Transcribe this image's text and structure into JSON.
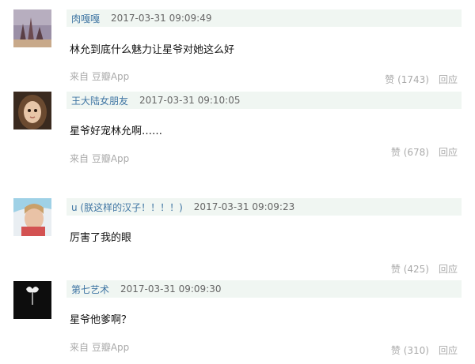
{
  "comments": [
    {
      "username": "肉嘎嘎",
      "time": "2017-03-31 09:09:49",
      "text": "林允到底什么魅力让星爷对她这么好",
      "source_prefix": "来自",
      "source_app": "豆瓣App",
      "likes": "赞 (1743)",
      "reply": "回应"
    },
    {
      "username": "王大陆女朋友",
      "time": "2017-03-31 09:10:05",
      "text": "星爷好宠林允啊……",
      "source_prefix": "来自",
      "source_app": "豆瓣App",
      "likes": "赞 (678)",
      "reply": "回应"
    },
    {
      "username": "u (朕这样的汉子！！！！)",
      "time": "2017-03-31 09:09:23",
      "text": "厉害了我的眼",
      "likes": "赞 (425)",
      "reply": "回应"
    },
    {
      "username": "第七艺术",
      "time": "2017-03-31 09:09:30",
      "text": "星爷他爹啊？",
      "source_prefix": "来自",
      "source_app": "豆瓣App",
      "likes": "赞 (310)",
      "reply": "回应"
    }
  ]
}
